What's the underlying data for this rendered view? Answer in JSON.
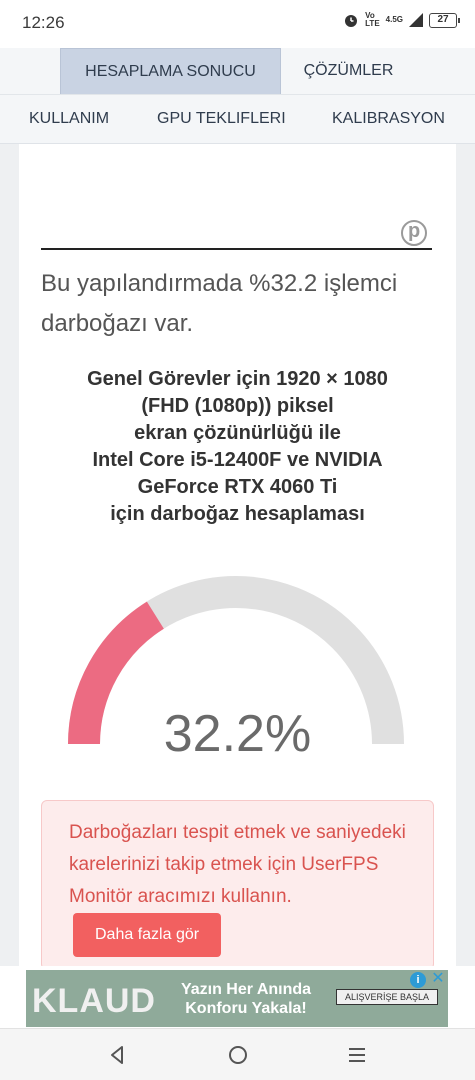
{
  "status_bar": {
    "time": "12:26",
    "network_top": "Vo",
    "network_bottom": "LTE",
    "network_gen": "4.5G",
    "battery": "27"
  },
  "tabs": {
    "row1": [
      "HESAPLAMA SONUCU",
      "ÇÖZÜMLER"
    ],
    "row2": [
      "KULLANIM",
      "GPU TEKLIFLERI",
      "KALIBRASYON"
    ]
  },
  "summary": {
    "prefix": "Bu yapılandırmada ",
    "percent": "%32.2",
    "middle": " işlemci ",
    "term": "darboğazı",
    "suffix": " var."
  },
  "calc_title": {
    "line1": "Genel Görevler için 1920 × 1080",
    "line2": "(FHD (1080p)) piksel",
    "line3": "ekran çözünürlüğü ile",
    "line4": "Intel Core i5-12400F ve NVIDIA",
    "line5": "GeForce RTX 4060 Ti",
    "line6": "için darboğaz hesaplaması"
  },
  "gauge": {
    "value_label": "32.2%",
    "fraction": 0.322,
    "fill_color": "#ec6b82",
    "track_color": "#e0e0e0"
  },
  "tip": {
    "text": "Darboğazları tespit etmek ve saniyedeki karelerinizi takip etmek için UserFPS Monitör aracımızı kullanın.",
    "button": "Daha fazla gör"
  },
  "ad": {
    "logo": "KLAUD",
    "slogan_line1": "Yazın Her Anında",
    "slogan_line2": "Konforu Yakala!",
    "cta": "ALIŞVERİŞE BAŞLA",
    "info": "i",
    "close": "✕"
  },
  "colors": {
    "accent_red": "#f26060",
    "tab_active_bg": "#c9d3e3"
  }
}
